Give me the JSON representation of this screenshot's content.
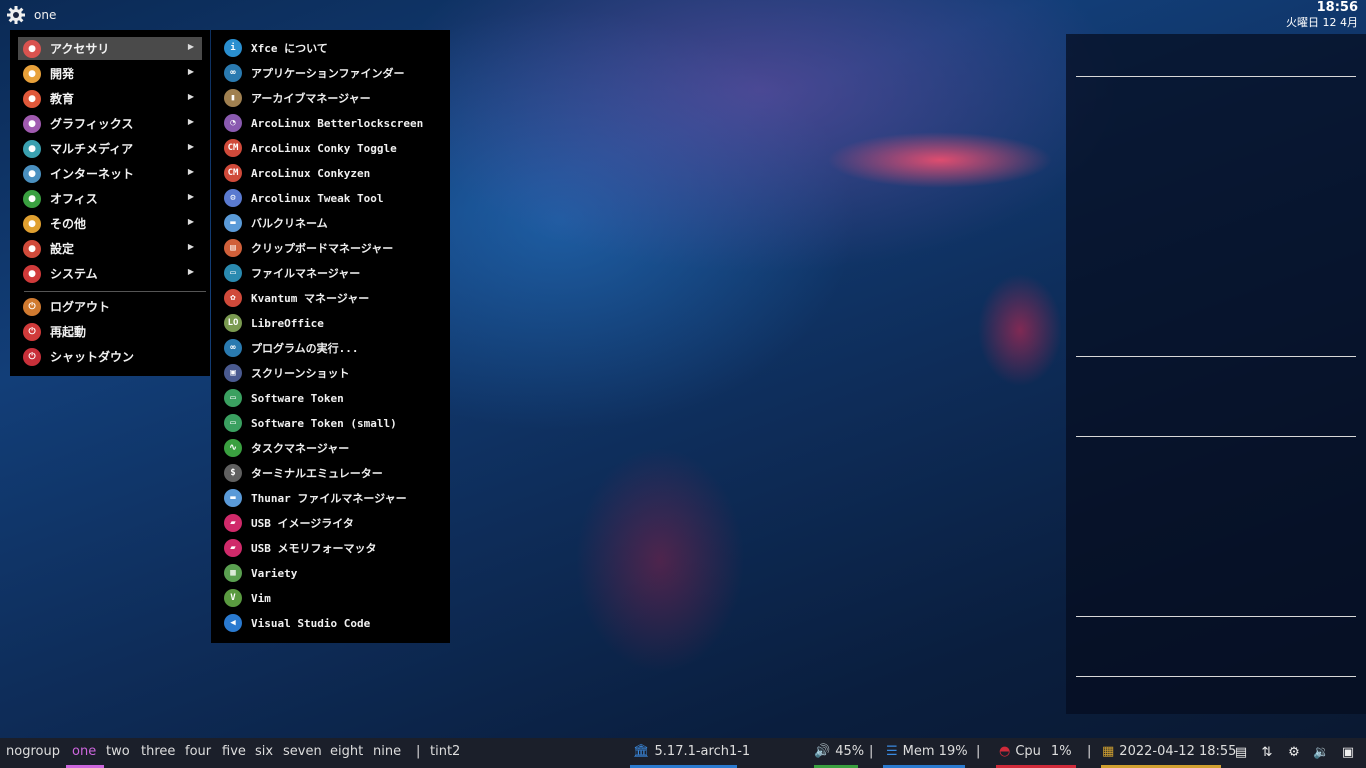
{
  "topbar": {
    "workspace": "one",
    "time": "18:56",
    "date": "火曜日 12 4月"
  },
  "menu": {
    "categories": [
      {
        "label": "アクセサリ",
        "icon": "accessories-icon",
        "color": "#d9534f"
      },
      {
        "label": "開発",
        "icon": "development-icon",
        "color": "#e8a13a"
      },
      {
        "label": "教育",
        "icon": "education-icon",
        "color": "#e0583a"
      },
      {
        "label": "グラフィックス",
        "icon": "graphics-icon",
        "color": "#a05ab0"
      },
      {
        "label": "マルチメディア",
        "icon": "multimedia-icon",
        "color": "#3aa0b0"
      },
      {
        "label": "インターネット",
        "icon": "internet-icon",
        "color": "#4a90c0"
      },
      {
        "label": "オフィス",
        "icon": "office-icon",
        "color": "#3aa040"
      },
      {
        "label": "その他",
        "icon": "other-icon",
        "color": "#e0a030"
      },
      {
        "label": "設定",
        "icon": "settings-icon",
        "color": "#d04a3a"
      },
      {
        "label": "システム",
        "icon": "system-icon",
        "color": "#d03a3a"
      }
    ],
    "session": [
      {
        "label": "ログアウト",
        "icon": "logout-icon",
        "color": "#d07a30"
      },
      {
        "label": "再起動",
        "icon": "restart-icon",
        "color": "#d03a3a"
      },
      {
        "label": "シャットダウン",
        "icon": "shutdown-icon",
        "color": "#c8303a"
      }
    ]
  },
  "submenu": {
    "items": [
      {
        "label": "Xfce について",
        "icon": "info-icon",
        "color": "#2a8fd0",
        "glyph": "i"
      },
      {
        "label": "アプリケーションファインダー",
        "icon": "app-finder-icon",
        "color": "#2a7ab0",
        "glyph": "∞"
      },
      {
        "label": "アーカイブマネージャー",
        "icon": "archive-icon",
        "color": "#a08050",
        "glyph": "▮"
      },
      {
        "label": "ArcoLinux Betterlockscreen",
        "icon": "lockscreen-icon",
        "color": "#8a5ab0",
        "glyph": "◔"
      },
      {
        "label": "ArcoLinux Conky Toggle",
        "icon": "conky-toggle-icon",
        "color": "#d04a3a",
        "glyph": "CM"
      },
      {
        "label": "ArcoLinux Conkyzen",
        "icon": "conkyzen-icon",
        "color": "#d04a3a",
        "glyph": "CM"
      },
      {
        "label": "Arcolinux Tweak Tool",
        "icon": "tweak-tool-icon",
        "color": "#5a7ad0",
        "glyph": "⚙"
      },
      {
        "label": "バルクリネーム",
        "icon": "folder-icon",
        "color": "#5a9ad8",
        "glyph": "▬"
      },
      {
        "label": "クリップボードマネージャー",
        "icon": "clipboard-icon",
        "color": "#d0603a",
        "glyph": "▤"
      },
      {
        "label": "ファイルマネージャー",
        "icon": "file-manager-icon",
        "color": "#2a8ab0",
        "glyph": "▭"
      },
      {
        "label": "Kvantum マネージャー",
        "icon": "kvantum-icon",
        "color": "#d04a3a",
        "glyph": "✿"
      },
      {
        "label": "LibreOffice",
        "icon": "libreoffice-icon",
        "color": "#7a9a50",
        "glyph": "LO"
      },
      {
        "label": "プログラムの実行...",
        "icon": "run-program-icon",
        "color": "#2a7ab0",
        "glyph": "∞"
      },
      {
        "label": "スクリーンショット",
        "icon": "screenshot-icon",
        "color": "#4a5a90",
        "glyph": "▣"
      },
      {
        "label": "Software Token",
        "icon": "software-token-icon",
        "color": "#3aa060",
        "glyph": "▭"
      },
      {
        "label": "Software Token (small)",
        "icon": "software-token-small-icon",
        "color": "#3aa060",
        "glyph": "▭"
      },
      {
        "label": "タスクマネージャー",
        "icon": "task-manager-icon",
        "color": "#3aa040",
        "glyph": "∿"
      },
      {
        "label": "ターミナルエミュレーター",
        "icon": "terminal-icon",
        "color": "#606060",
        "glyph": "$"
      },
      {
        "label": "Thunar ファイルマネージャー",
        "icon": "thunar-folder-icon",
        "color": "#5a9ad8",
        "glyph": "▬"
      },
      {
        "label": "USB イメージライタ",
        "icon": "usb-writer-icon",
        "color": "#d02a6a",
        "glyph": "▰"
      },
      {
        "label": "USB メモリフォーマッタ",
        "icon": "usb-formatter-icon",
        "color": "#d02a6a",
        "glyph": "▰"
      },
      {
        "label": "Variety",
        "icon": "variety-icon",
        "color": "#5aa050",
        "glyph": "▦"
      },
      {
        "label": "Vim",
        "icon": "vim-icon",
        "color": "#5a9a40",
        "glyph": "V"
      },
      {
        "label": "Visual Studio Code",
        "icon": "vscode-icon",
        "color": "#2a7ad0",
        "glyph": "◀"
      }
    ]
  },
  "bottombar": {
    "workspaces": [
      "nogroup",
      "one",
      "two",
      "three",
      "four",
      "five",
      "six",
      "seven",
      "eight",
      "nine"
    ],
    "current_workspace": "one",
    "separator": "|",
    "panel_name": "tint2",
    "kernel": "5.17.1-arch1-1",
    "volume": "45%",
    "mem": "Mem 19%",
    "cpu_label": "Cpu",
    "cpu_value": "1%",
    "datetime": "2022-04-12 18:55",
    "colors": {
      "kernel": "#2a7ad0",
      "volume": "#3aa040",
      "mem": "#2a7ad0",
      "cpu": "#d02a3a",
      "date": "#d0a030",
      "current_ws": "#cc66dd"
    }
  }
}
